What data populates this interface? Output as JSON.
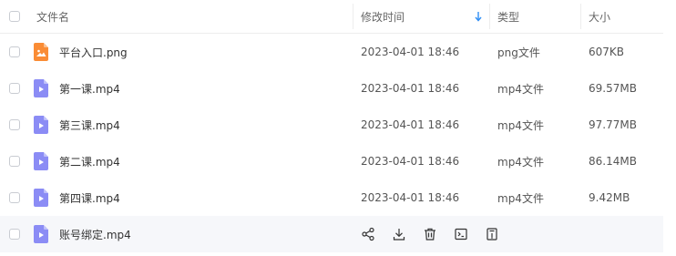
{
  "columns": {
    "name": "文件名",
    "modified": "修改时间",
    "type": "类型",
    "size": "大小"
  },
  "sort": {
    "column": "modified",
    "direction": "desc",
    "icon": "arrow-down-icon",
    "color": "#2f8ef5"
  },
  "files": [
    {
      "name": "平台入口.png",
      "modified": "2023-04-01 18:46",
      "type": "png文件",
      "size": "607KB",
      "kind": "image",
      "icon_color": "#fa8c35"
    },
    {
      "name": "第一课.mp4",
      "modified": "2023-04-01 18:46",
      "type": "mp4文件",
      "size": "69.57MB",
      "kind": "video",
      "icon_color": "#8b8cf5"
    },
    {
      "name": "第三课.mp4",
      "modified": "2023-04-01 18:46",
      "type": "mp4文件",
      "size": "97.77MB",
      "kind": "video",
      "icon_color": "#8b8cf5"
    },
    {
      "name": "第二课.mp4",
      "modified": "2023-04-01 18:46",
      "type": "mp4文件",
      "size": "86.14MB",
      "kind": "video",
      "icon_color": "#8b8cf5"
    },
    {
      "name": "第四课.mp4",
      "modified": "2023-04-01 18:46",
      "type": "mp4文件",
      "size": "9.42MB",
      "kind": "video",
      "icon_color": "#8b8cf5"
    },
    {
      "name": "账号绑定.mp4",
      "modified": "",
      "type": "",
      "size": "",
      "kind": "video",
      "icon_color": "#8b8cf5",
      "hovered": true
    }
  ],
  "row_actions": [
    "share-icon",
    "download-icon",
    "delete-icon",
    "rename-icon",
    "more-info-icon"
  ]
}
